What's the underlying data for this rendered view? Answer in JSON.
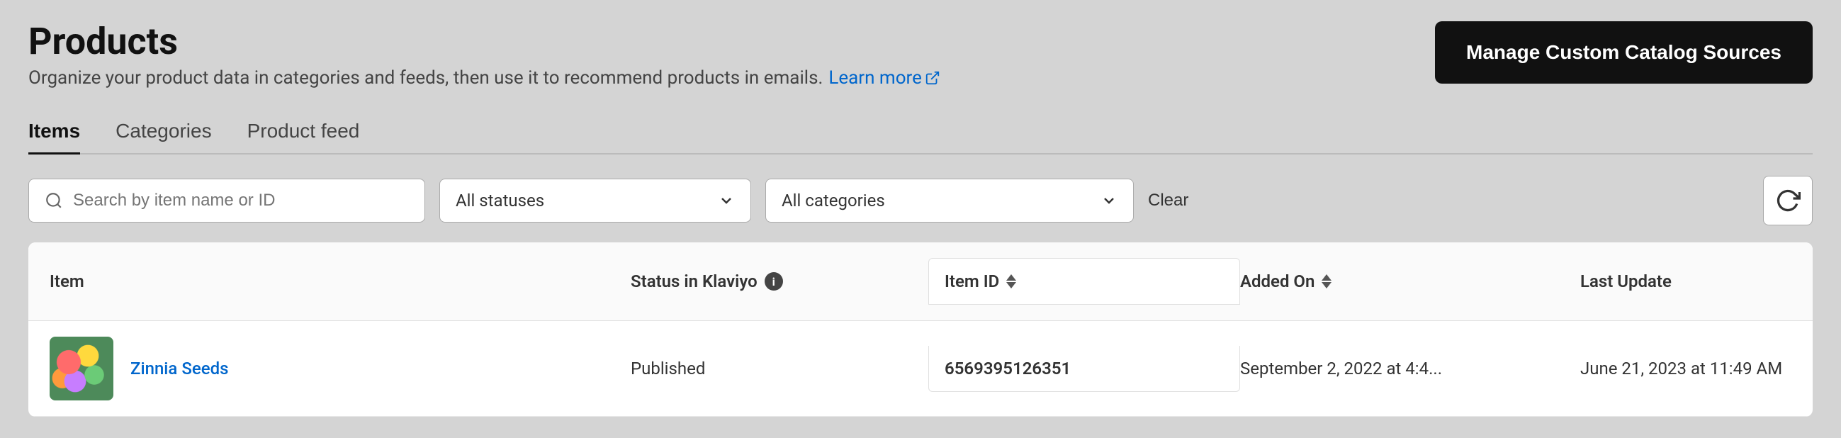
{
  "page": {
    "title": "Products",
    "subtitle": "Organize your product data in categories and feeds, then use it to recommend products in emails.",
    "learn_more_label": "Learn more",
    "manage_btn_label": "Manage Custom Catalog Sources"
  },
  "tabs": [
    {
      "label": "Items",
      "active": true
    },
    {
      "label": "Categories",
      "active": false
    },
    {
      "label": "Product feed",
      "active": false
    }
  ],
  "toolbar": {
    "search_placeholder": "Search by item name or ID",
    "status_dropdown_label": "All statuses",
    "categories_dropdown_label": "All categories",
    "clear_label": "Clear"
  },
  "table": {
    "columns": {
      "item": "Item",
      "status": "Status in Klaviyo",
      "item_id": "Item ID",
      "added_on": "Added On",
      "last_update": "Last Update"
    },
    "rows": [
      {
        "name": "Zinnia Seeds",
        "status": "Published",
        "item_id": "6569395126351",
        "added_on": "September 2, 2022 at 4:4...",
        "last_update": "June 21, 2023 at 11:49 AM"
      }
    ]
  }
}
